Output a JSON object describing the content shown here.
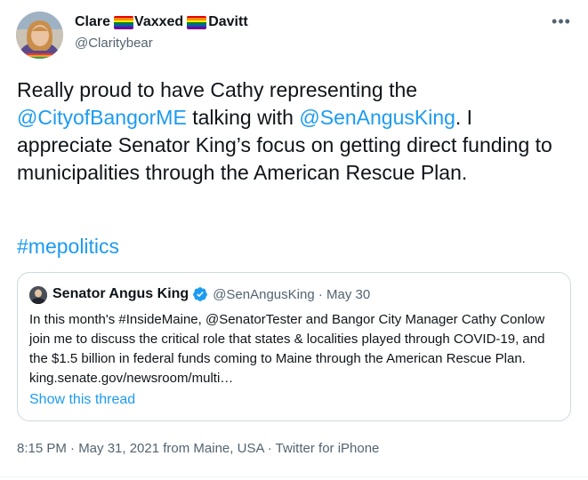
{
  "author": {
    "name_part1": "Clare",
    "name_part2": "Vaxxed",
    "name_part3": "Davitt",
    "handle": "@Claritybear",
    "name_flags": [
      "rainbow-flag-icon",
      "rainbow-flag-icon"
    ]
  },
  "tweet": {
    "text_1": "Really proud to have Cathy representing the ",
    "mention_1": "@CityofBangorME",
    "text_2": " talking with ",
    "mention_2": "@SenAngusKing",
    "text_3": ". I appreciate Senator King’s focus on getting direct funding to municipalities through the American Rescue Plan.",
    "hashtag": "#mepolitics"
  },
  "quoted_tweet": {
    "author_name": "Senator Angus King",
    "author_handle": "@SenAngusKing",
    "separator": " · ",
    "date": "May 30",
    "verified": true,
    "text": "In this month's #InsideMaine, @SenatorTester and Bangor City Manager Cathy Conlow join me to discuss the critical role that states & localities played through COVID-19, and the $1.5 billion in federal funds coming to Maine through the American Rescue Plan. king.senate.gov/newsroom/multi…",
    "show_thread_label": "Show this thread"
  },
  "meta": {
    "timestamp": "8:15 PM · May 31, 2021 from Maine, USA · Twitter for iPhone"
  },
  "more_icon": "more-horizontal-icon",
  "colors": {
    "link": "#1d9bf0",
    "secondary_text": "#536471",
    "primary_text": "#0f1419",
    "border": "#cfd9de"
  }
}
